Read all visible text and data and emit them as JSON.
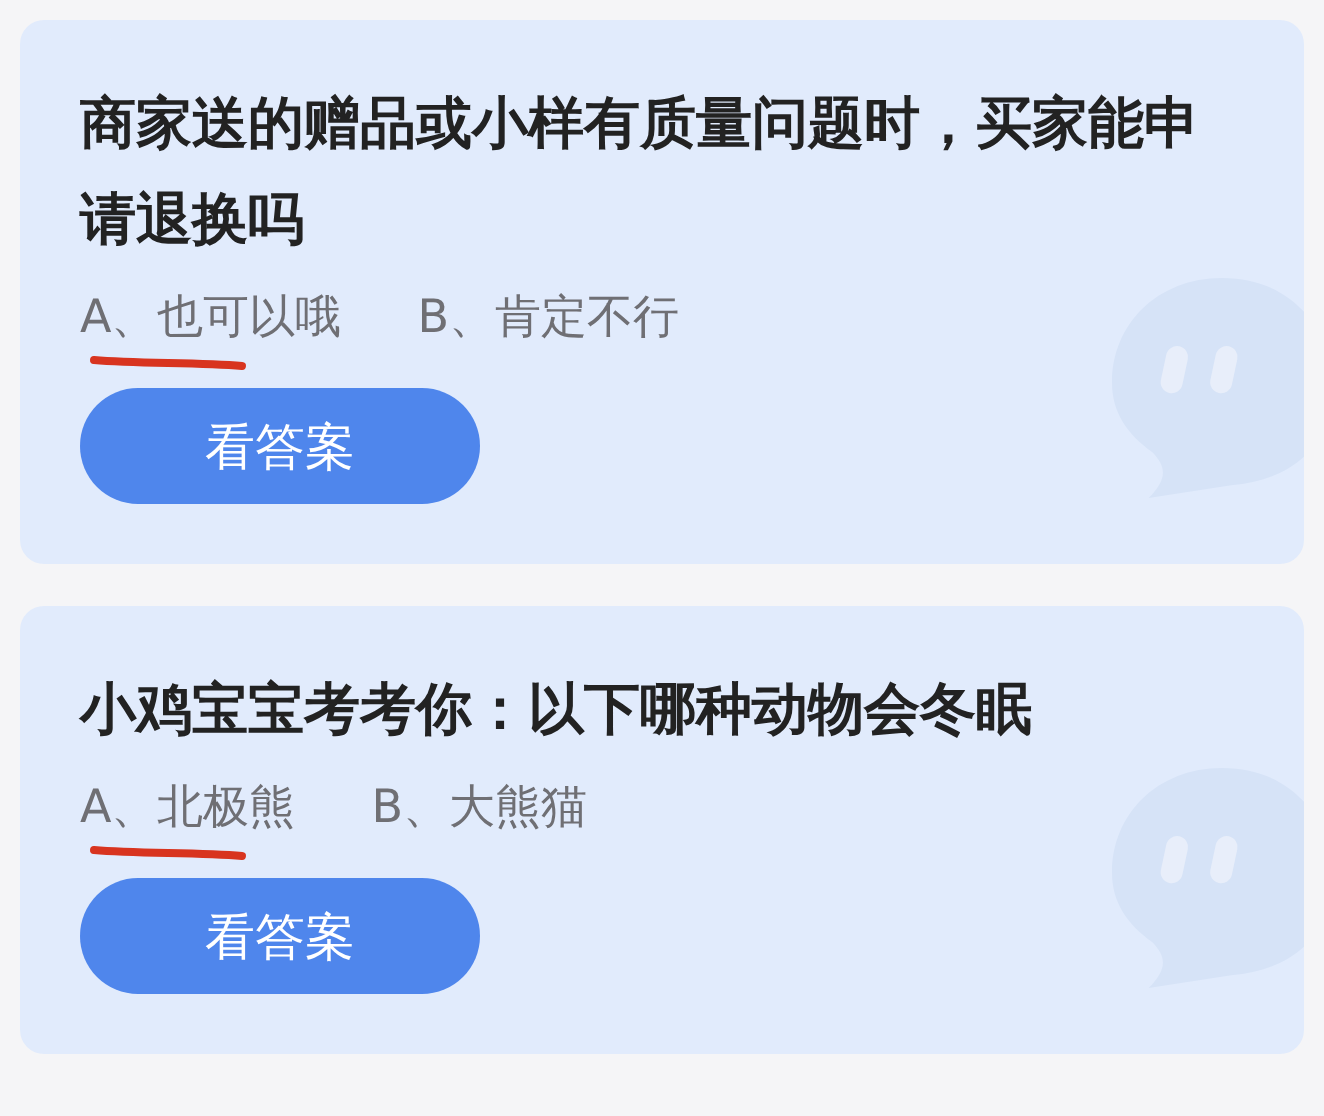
{
  "cards": [
    {
      "question": "商家送的赠品或小样有质量问题时，买家能申请退换吗",
      "options": [
        {
          "label": "A、也可以哦",
          "marked": true
        },
        {
          "label": "B、肯定不行",
          "marked": false
        }
      ],
      "button": "看答案"
    },
    {
      "question": "小鸡宝宝考考你：以下哪种动物会冬眠",
      "options": [
        {
          "label": "A、北极熊",
          "marked": true
        },
        {
          "label": "B、大熊猫",
          "marked": false
        }
      ],
      "button": "看答案"
    }
  ]
}
